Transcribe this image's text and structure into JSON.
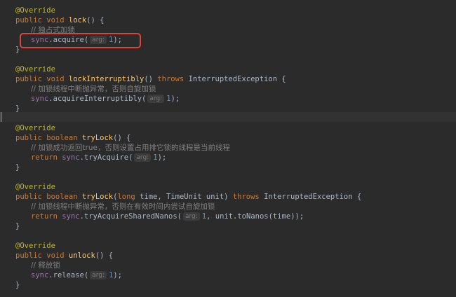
{
  "methods": [
    {
      "annotation": "@Override",
      "signature": {
        "public": "public",
        "ret": "void",
        "name": "lock",
        "params": "() {"
      },
      "comment": "// 独占式加锁",
      "body": {
        "field": "sync",
        "call": ".acquire(",
        "hint": "arg:",
        "arg": "1",
        "tail": ");"
      },
      "close": "}"
    },
    {
      "annotation": "@Override",
      "signature": {
        "public": "public",
        "ret": "void",
        "name": "lockInterruptibly",
        "params": "() ",
        "throws": "throws",
        "exception": " InterruptedException {"
      },
      "comment": "// 加锁线程中断抛异常，否则自旋加锁",
      "body": {
        "field": "sync",
        "call": ".acquireInterruptibly(",
        "hint": "arg:",
        "arg": "1",
        "tail": ");"
      },
      "close": "}"
    },
    {
      "annotation": "@Override",
      "signature": {
        "public": "public",
        "ret": "boolean",
        "name": "tryLock",
        "params": "() {"
      },
      "comment": "// 加锁成功返回true，否则设置占用排它锁的线程是当前线程",
      "body": {
        "ret": "return",
        "field": "sync",
        "call": ".tryAcquire(",
        "hint": "arg:",
        "arg": "1",
        "tail": ");"
      },
      "close": "}"
    },
    {
      "annotation": "@Override",
      "signature": {
        "public": "public",
        "ret": "boolean",
        "name": "tryLock",
        "params_open": "(",
        "p1type": "long",
        "p1rest": " time, TimeUnit unit) ",
        "throws": "throws",
        "exception": " InterruptedException {"
      },
      "comment": "// 加锁线程中断抛异常，否则在有效时间内尝试自旋加锁",
      "body": {
        "ret": "return",
        "field": "sync",
        "call": ".tryAcquireSharedNanos(",
        "hint": "arg:",
        "arg": "1",
        "tail": ", unit.toNanos(time));"
      },
      "close": "}"
    },
    {
      "annotation": "@Override",
      "signature": {
        "public": "public",
        "ret": "void",
        "name": "unlock",
        "params": "() {"
      },
      "comment": "// 释放锁",
      "body": {
        "field": "sync",
        "call": ".release(",
        "hint": "arg:",
        "arg": "1",
        "tail": ");"
      },
      "close": "}"
    }
  ],
  "colors": {
    "background": "#2b2b2b",
    "keyword": "#cc7832",
    "annotation": "#bbb529",
    "method": "#ffc66d",
    "field": "#9876aa",
    "number": "#6897bb",
    "highlight": "#d9443b"
  }
}
